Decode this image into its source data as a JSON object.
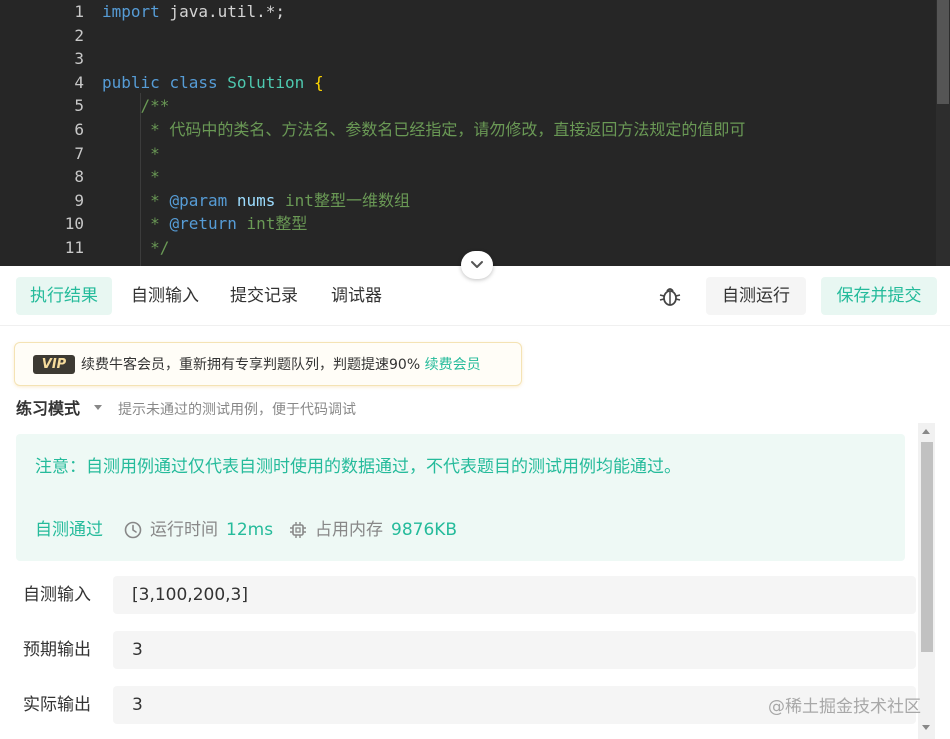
{
  "editor": {
    "lines": [
      {
        "num": "1",
        "tokens": [
          {
            "t": "import",
            "c": "kw"
          },
          {
            "t": " java.util.*;",
            "c": ""
          }
        ]
      },
      {
        "num": "2",
        "tokens": []
      },
      {
        "num": "3",
        "tokens": []
      },
      {
        "num": "4",
        "tokens": [
          {
            "t": "public",
            "c": "kw"
          },
          {
            "t": " ",
            "c": ""
          },
          {
            "t": "class",
            "c": "kw"
          },
          {
            "t": " ",
            "c": ""
          },
          {
            "t": "Solution",
            "c": "cls"
          },
          {
            "t": " ",
            "c": ""
          },
          {
            "t": "{",
            "c": "brace"
          }
        ]
      },
      {
        "num": "5",
        "tokens": [
          {
            "t": "    /**",
            "c": "cm"
          }
        ]
      },
      {
        "num": "6",
        "tokens": [
          {
            "t": "     * 代码中的类名、方法名、参数名已经指定，请勿修改，直接返回方法规定的值即可",
            "c": "cm"
          }
        ]
      },
      {
        "num": "7",
        "tokens": [
          {
            "t": "     *",
            "c": "cm"
          }
        ]
      },
      {
        "num": "8",
        "tokens": [
          {
            "t": "     *",
            "c": "cm"
          }
        ]
      },
      {
        "num": "9",
        "tokens": [
          {
            "t": "     * ",
            "c": "cm"
          },
          {
            "t": "@param",
            "c": "tag"
          },
          {
            "t": " ",
            "c": "cm"
          },
          {
            "t": "nums",
            "c": "pname"
          },
          {
            "t": " int整型一维数组",
            "c": "cm"
          }
        ]
      },
      {
        "num": "10",
        "tokens": [
          {
            "t": "     * ",
            "c": "cm"
          },
          {
            "t": "@return",
            "c": "tag"
          },
          {
            "t": " int整型",
            "c": "cm"
          }
        ]
      },
      {
        "num": "11",
        "tokens": [
          {
            "t": "     */",
            "c": "cm"
          }
        ]
      }
    ]
  },
  "tabs": [
    {
      "label": "执行结果",
      "active": true
    },
    {
      "label": "自测输入",
      "active": false
    },
    {
      "label": "提交记录",
      "active": false
    },
    {
      "label": "调试器",
      "active": false
    }
  ],
  "actions": {
    "run_label": "自测运行",
    "submit_label": "保存并提交",
    "debug_icon": "bug-icon"
  },
  "vip": {
    "badge": "VIP",
    "text": "续费牛客会员，重新拥有专享判题队列，判题提速90%",
    "link": "续费会员"
  },
  "mode": {
    "title": "练习模式",
    "hint": "提示未通过的测试用例，便于代码调试"
  },
  "result": {
    "notice": "注意：自测用例通过仅代表自测时使用的数据通过，不代表题目的测试用例均能通过。",
    "status": "自测通过",
    "time_label": "运行时间",
    "time_value": "12ms",
    "memory_label": "占用内存",
    "memory_value": "9876KB",
    "rows": [
      {
        "label": "自测输入",
        "value": "[3,100,200,3]"
      },
      {
        "label": "预期输出",
        "value": "3"
      },
      {
        "label": "实际输出",
        "value": "3"
      }
    ]
  },
  "watermark": "@稀土掘金技术社区",
  "colors": {
    "accent": "#25bb9b",
    "editor_bg": "#262626",
    "keyword": "#569cd6",
    "comment": "#6a9955"
  }
}
